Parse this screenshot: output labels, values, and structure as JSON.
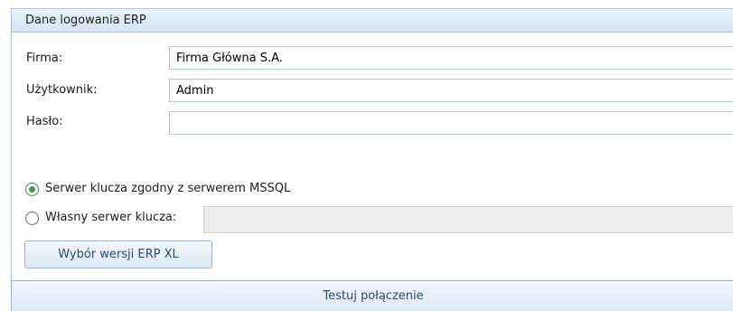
{
  "panel": {
    "title": "Dane logowania ERP"
  },
  "fields": {
    "firma": {
      "label": "Firma:",
      "value": "Firma Główna S.A."
    },
    "uzytkownik": {
      "label": "Użytkownik:",
      "value": "Admin"
    },
    "haslo": {
      "label": "Hasło:",
      "value": ""
    }
  },
  "key_server": {
    "option_mssql": {
      "label": "Serwer klucza zgodny z serwerem MSSQL",
      "selected": true
    },
    "option_custom": {
      "label": "Własny serwer klucza:",
      "selected": false,
      "value": ""
    }
  },
  "buttons": {
    "version_label": "Wybór wersji ERP XL",
    "test_label": "Testuj połączenie"
  },
  "colors": {
    "header_bg": "#dde8f5",
    "border": "#a9c0da",
    "radio_selected": "#3aa53a"
  }
}
